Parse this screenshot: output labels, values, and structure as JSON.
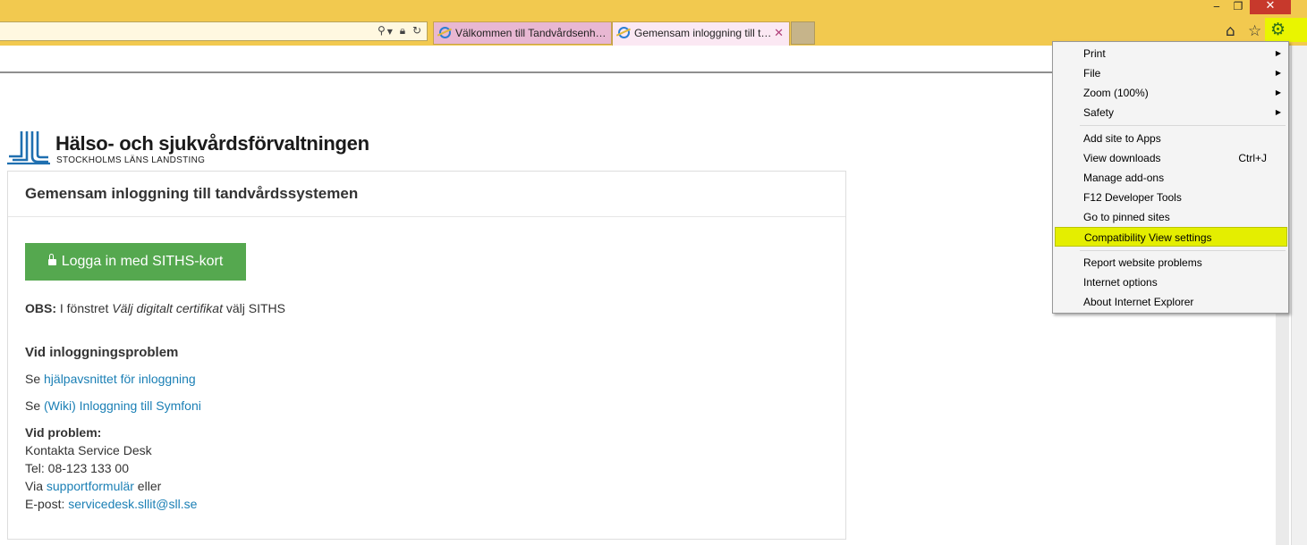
{
  "window": {
    "minimize": "‒",
    "restore": "❐",
    "close": "✕"
  },
  "tabs": [
    {
      "label": "Välkommen till Tandvårdsenh…"
    },
    {
      "label": "Gemensam inloggning till t…",
      "close": "✕"
    }
  ],
  "toolbar_icons": [
    "home-icon",
    "star-icon",
    "gear-icon"
  ],
  "header": {
    "org_name": "Hälso- och sjukvårdsförvaltningen",
    "org_sub": "STOCKHOLMS LÄNS LANDSTING"
  },
  "panel": {
    "title": "Gemensam inloggning till tandvårdssystemen",
    "login_button": "Logga in med SITHS-kort",
    "obs_label": "OBS:",
    "obs_text_1": " I fönstret ",
    "obs_text_italic": "Välj digitalt certifikat",
    "obs_text_2": " välj SITHS",
    "problem_heading": "Vid inloggningsproblem",
    "help_prefix": "Se ",
    "help_link": "hjälpavsnittet för inloggning",
    "wiki_prefix": "Se ",
    "wiki_link": "(Wiki) Inloggning till Symfoni",
    "vid_problem": "Vid problem:",
    "contact_line": "Kontakta Service Desk",
    "tel_line": "Tel: 08-123 133 00",
    "via_prefix": "Via ",
    "support_link": "supportformulär",
    "via_suffix": " eller",
    "email_prefix": "E-post: ",
    "email_link": "servicedesk.sllit@sll.se"
  },
  "menu": {
    "items": [
      {
        "label": "Print",
        "arrow": "▶"
      },
      {
        "label": "File",
        "arrow": "▶"
      },
      {
        "label": "Zoom (100%)",
        "arrow": "▶"
      },
      {
        "label": "Safety",
        "arrow": "▶"
      },
      {
        "label": "Add site to Apps"
      },
      {
        "label": "View downloads",
        "shortcut": "Ctrl+J"
      },
      {
        "label": "Manage add-ons"
      },
      {
        "label": "F12 Developer Tools"
      },
      {
        "label": "Go to pinned sites"
      },
      {
        "label": "Compatibility View settings",
        "highlighted": true
      },
      {
        "label": "Report website problems"
      },
      {
        "label": "Internet options"
      },
      {
        "label": "About Internet Explorer"
      }
    ]
  },
  "colors": {
    "chrome": "#f2c94f",
    "highlight": "#e4ee00",
    "button_green": "#55a84f",
    "link": "#1a7fb5"
  }
}
